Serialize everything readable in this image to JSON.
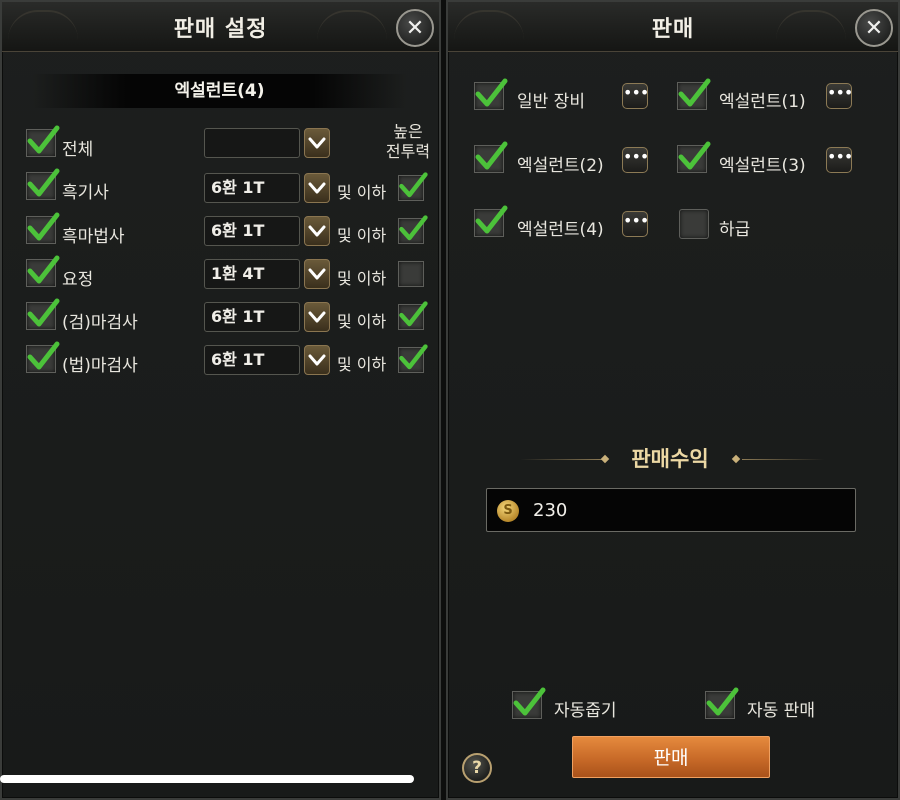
{
  "left_panel": {
    "title": "판매 설정",
    "section_title": "엑설런트(4)",
    "high_power_label_line1": "높은",
    "high_power_label_line2": "전투력",
    "rows": [
      {
        "label": "전체",
        "checked": true,
        "value": "",
        "below_label": "",
        "high_checked": null
      },
      {
        "label": "흑기사",
        "checked": true,
        "value": "6환 1T",
        "below_label": "및 이하",
        "high_checked": true
      },
      {
        "label": "흑마법사",
        "checked": true,
        "value": "6환 1T",
        "below_label": "및 이하",
        "high_checked": true
      },
      {
        "label": "요정",
        "checked": true,
        "value": "1환 4T",
        "below_label": "및 이하",
        "high_checked": false
      },
      {
        "label": "(검)마검사",
        "checked": true,
        "value": "6환 1T",
        "below_label": "및 이하",
        "high_checked": true
      },
      {
        "label": "(법)마검사",
        "checked": true,
        "value": "6환 1T",
        "below_label": "및 이하",
        "high_checked": true
      }
    ]
  },
  "right_panel": {
    "title": "판매",
    "options": [
      {
        "label": "일반 장비",
        "checked": true,
        "more": "•••"
      },
      {
        "label": "엑설런트(1)",
        "checked": true,
        "more": "•••"
      },
      {
        "label": "엑설런트(2)",
        "checked": true,
        "more": "•••"
      },
      {
        "label": "엑설런트(3)",
        "checked": true,
        "more": "•••"
      },
      {
        "label": "엑설런트(4)",
        "checked": true,
        "more": "•••"
      },
      {
        "label": "하급",
        "checked": false,
        "more": ""
      }
    ],
    "revenue_title": "판매수익",
    "revenue_value": "230",
    "coin_symbol": "S",
    "auto_pickup_label": "자동줍기",
    "auto_sell_label": "자동 판매",
    "sell_button": "판매",
    "help_symbol": "?"
  },
  "colors": {
    "check_green": "#4cc23a",
    "sell_orange": "#d4752f",
    "gold_text": "#ecd8a4"
  },
  "close_symbol": "✕"
}
